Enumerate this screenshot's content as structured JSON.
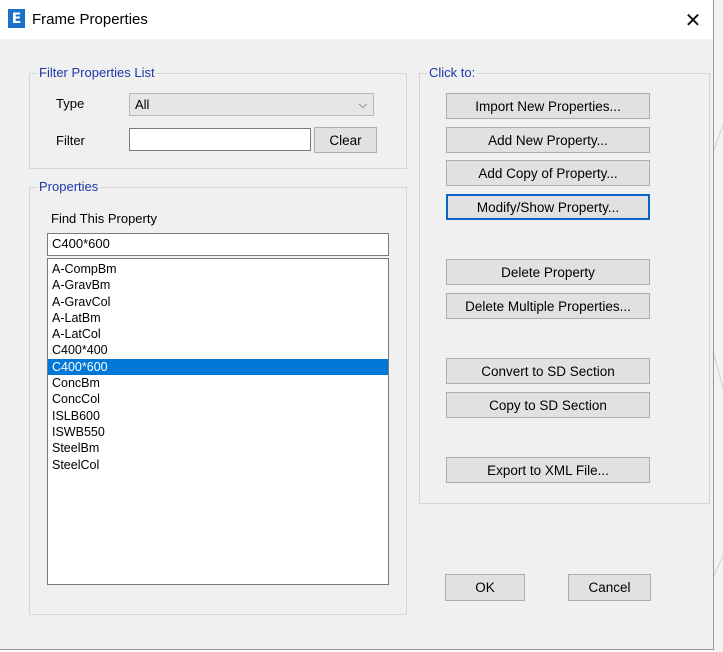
{
  "window": {
    "title": "Frame Properties",
    "app_icon_letter": "E",
    "close_glyph": "✕"
  },
  "filter_group": {
    "legend": "Filter Properties List",
    "type_label": "Type",
    "type_value": "All",
    "filter_label": "Filter",
    "filter_value": "",
    "clear_label": "Clear"
  },
  "properties_group": {
    "legend": "Properties",
    "find_label": "Find This Property",
    "find_value": "C400*600",
    "items": [
      "A-CompBm",
      "A-GravBm",
      "A-GravCol",
      "A-LatBm",
      "A-LatCol",
      "C400*400",
      "C400*600",
      "ConcBm",
      "ConcCol",
      "ISLB600",
      "ISWB550",
      "SteelBm",
      "SteelCol"
    ],
    "selected_item": "C400*600"
  },
  "click_to": {
    "legend": "Click to:",
    "import_label": "Import New Properties...",
    "add_label": "Add New Property...",
    "add_copy_label": "Add Copy of Property...",
    "modify_label": "Modify/Show Property...",
    "delete_label": "Delete Property",
    "delete_multiple_label": "Delete Multiple Properties...",
    "convert_label": "Convert to SD Section",
    "copy_sd_label": "Copy to SD Section",
    "export_label": "Export to XML File..."
  },
  "footer": {
    "ok_label": "OK",
    "cancel_label": "Cancel"
  },
  "colors": {
    "accent": "#0078d7",
    "group_label": "#1a3aa8",
    "dialog_bg": "#f0f0f0"
  }
}
